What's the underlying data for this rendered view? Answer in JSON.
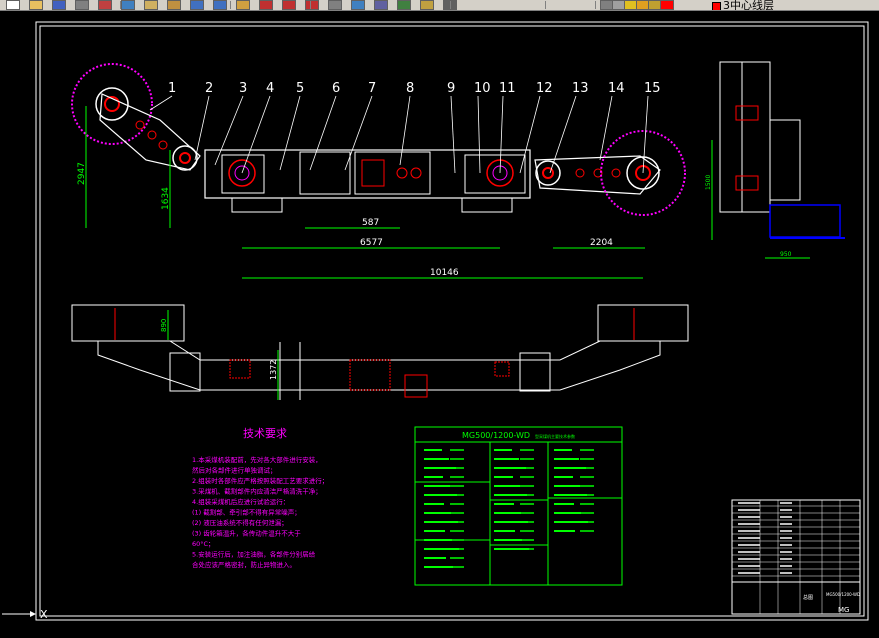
{
  "toolbar": {
    "layer_name": "3中心线层",
    "icons": [
      "new-icon",
      "open-icon",
      "save-icon",
      "print-icon",
      "cut-icon",
      "copy-icon",
      "paste-icon",
      "match-icon",
      "undo-icon",
      "redo-icon",
      "pan-icon",
      "zoom-realtime-icon",
      "zoom-window-icon",
      "zoom-previous-icon",
      "properties-icon",
      "design-center-icon",
      "tool-palette-icon",
      "sheet-set-icon",
      "markup-icon",
      "calculator-icon",
      "layer-manager-icon",
      "layer-state-icon",
      "layer-bulb-icon",
      "layer-sun-icon",
      "layer-lock-icon",
      "layer-color-icon"
    ]
  },
  "drawing": {
    "part_numbers": [
      "1",
      "2",
      "3",
      "4",
      "5",
      "6",
      "7",
      "8",
      "9",
      "10",
      "11",
      "12",
      "13",
      "14",
      "15"
    ],
    "dimensions": {
      "height_left": "2947",
      "height_body": "1634",
      "mid_dim": "587",
      "span_a": "6577",
      "span_b": "2204",
      "overall": "10146",
      "plan_width": "890",
      "plan_depth": "1372",
      "side_h": "1500",
      "side_w": "950"
    },
    "tech_requirements": {
      "title": "技术要求",
      "lines": [
        "1.本采煤机装配前，先对各大部件进行安装，",
        "  然后对各部件进行单独调试；",
        "2.组装时各部件应严格按照装配工艺要求进行；",
        "3.采煤机、截割部件内应清洁严格清洗干净；",
        "4.组装采煤机后应进行试验运行：",
        "  (1) 截割部、牵引部不得有异常噪声；",
        "  (2) 液压油系统不得有任何泄漏；",
        "  (3) 齿轮箱温升，各传动件温升不大于",
        "      60°C；",
        "5.安装运行后，加注油脂，各部件分别居给",
        "  合处应该严格密封，防止异物进入。"
      ]
    },
    "spec_table": {
      "title": "MG500/1200-WD",
      "subtitle": "型采煤机主要技术参数"
    },
    "title_block": {
      "drawing_code": "MG500/1200-WD",
      "label": "MG",
      "name": "总图"
    }
  },
  "colors": {
    "bg": "#000000",
    "drawing_line": "#ffffff",
    "center_line": "#ff0000",
    "dimension": "#00ff00",
    "detail_magenta": "#ff00ff",
    "blue_detail": "#0000ff",
    "part_label": "#ffffff"
  }
}
